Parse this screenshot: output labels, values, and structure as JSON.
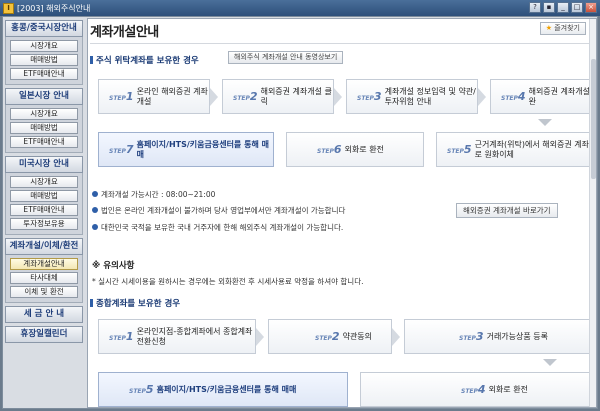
{
  "window": {
    "title": "[2003] 해외주식안내",
    "app_icon_glyph": "I"
  },
  "sidebar": {
    "groups": [
      {
        "head": "홍콩/중국시장안내",
        "items": [
          "시장개요",
          "매매방법",
          "ETF매매안내"
        ]
      },
      {
        "head": "일본시장 안내",
        "items": [
          "시장개요",
          "매매방법",
          "ETF매매안내"
        ]
      },
      {
        "head": "미국시장 안내",
        "items": [
          "시장개요",
          "매매방법",
          "ETF매매안내",
          "투자정보유용"
        ]
      },
      {
        "head": "계좌개설/이체/환전",
        "items": [
          "계좌개설안내",
          "타사대체",
          "이체 및 환전"
        ]
      },
      {
        "head": "세 금 안 내",
        "items": []
      },
      {
        "head": "휴장일캘린더",
        "items": []
      }
    ],
    "active_item": "계좌개설안내"
  },
  "content": {
    "page_title": "계좌개설안내",
    "favorite_label": "즐겨찾기",
    "section1": {
      "title": "주식 위탁계좌를 보유한 경우",
      "video_button": "해외주식 계좌개설 안내 동영상보기",
      "steps": [
        {
          "no": "1",
          "text": "온라인 해외증권 계좌개설"
        },
        {
          "no": "2",
          "text": "해외증권 계좌개설 클릭"
        },
        {
          "no": "3",
          "text": "계좌개설 정보입력 및 약관/투자위험 안내"
        },
        {
          "no": "4",
          "text": "해외증권 계좌개설 완"
        },
        {
          "no": "5",
          "text": "근거계좌(위탁)에서 해외증권 계좌로 원화이체"
        },
        {
          "no": "6",
          "text": "외화로 환전"
        },
        {
          "no": "7",
          "text": "홈페이지/HTS/키움금융센터를 통해 매매"
        }
      ]
    },
    "info": {
      "hours": "계좌개설 가능시간 : 08:00~21:00",
      "corporate": "법인은 온라인 계좌개설이 불가하며 당사 영업부에서만 계좌개설이 가능합니다",
      "residents": "대한민국 국적을 보유한 국내 거주자에 한해 해외주식 계좌개설이 가능합니다.",
      "shortcut_button": "해외증권 계좌개설 바로가기"
    },
    "caution": {
      "title": "※ 유의사항",
      "text": "* 실시간 시세이용을 원하시는 경우에는 외화환전 후 시세사용료 약정을 하셔야 합니다."
    },
    "section2": {
      "title": "종합계좌를 보유한 경우",
      "steps": [
        {
          "no": "1",
          "text": "온라인지점-종합계좌에서 종합계좌 전환신청"
        },
        {
          "no": "2",
          "text": "약관동의"
        },
        {
          "no": "3",
          "text": "거래가능상품 등록"
        },
        {
          "no": "4",
          "text": "외화로 환전"
        },
        {
          "no": "5",
          "text": "홈페이지/HTS/키움금융센터를 통해 매매"
        }
      ]
    },
    "step_prefix": "STEP"
  },
  "colors": {
    "title_bar": "#2d4f7a",
    "accent": "#2f5fa8",
    "sidebar_head_text": "#1d3c78"
  }
}
